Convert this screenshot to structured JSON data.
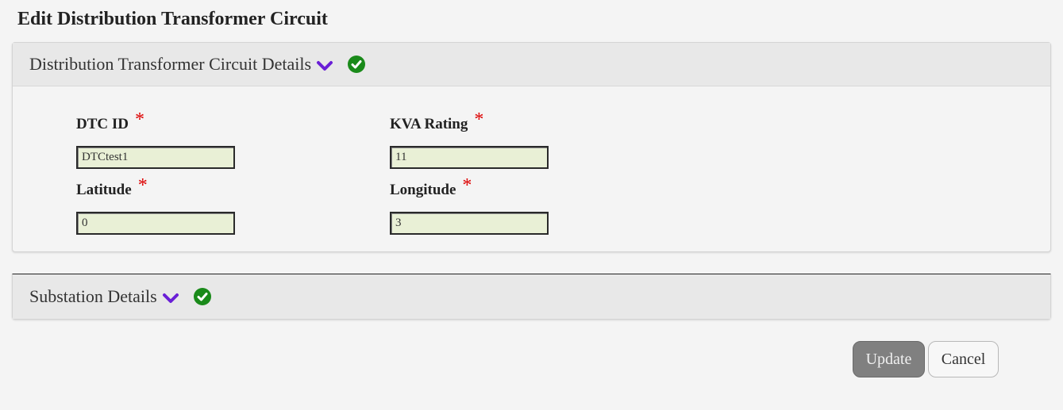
{
  "page": {
    "title": "Edit Distribution Transformer Circuit"
  },
  "sections": [
    {
      "title": "Distribution Transformer Circuit Details",
      "expand_icon": "chevron-down-icon",
      "status_icon": "check-circle-icon",
      "fields": [
        {
          "label": "DTC ID",
          "required": "*",
          "value": "DTCtest1"
        },
        {
          "label": "KVA Rating",
          "required": "*",
          "value": "11"
        },
        {
          "label": "Latitude",
          "required": "*",
          "value": "0"
        },
        {
          "label": "Longitude",
          "required": "*",
          "value": "3"
        }
      ]
    },
    {
      "title": "Substation Details",
      "expand_icon": "chevron-down-icon",
      "status_icon": "check-circle-icon"
    }
  ],
  "actions": {
    "update_label": "Update",
    "cancel_label": "Cancel"
  },
  "colors": {
    "accent_chevron": "#6a1fd6",
    "success": "#1a8a1a",
    "required": "#dd0000",
    "input_bg": "#e9f0d6",
    "update_bg": "#808080"
  }
}
